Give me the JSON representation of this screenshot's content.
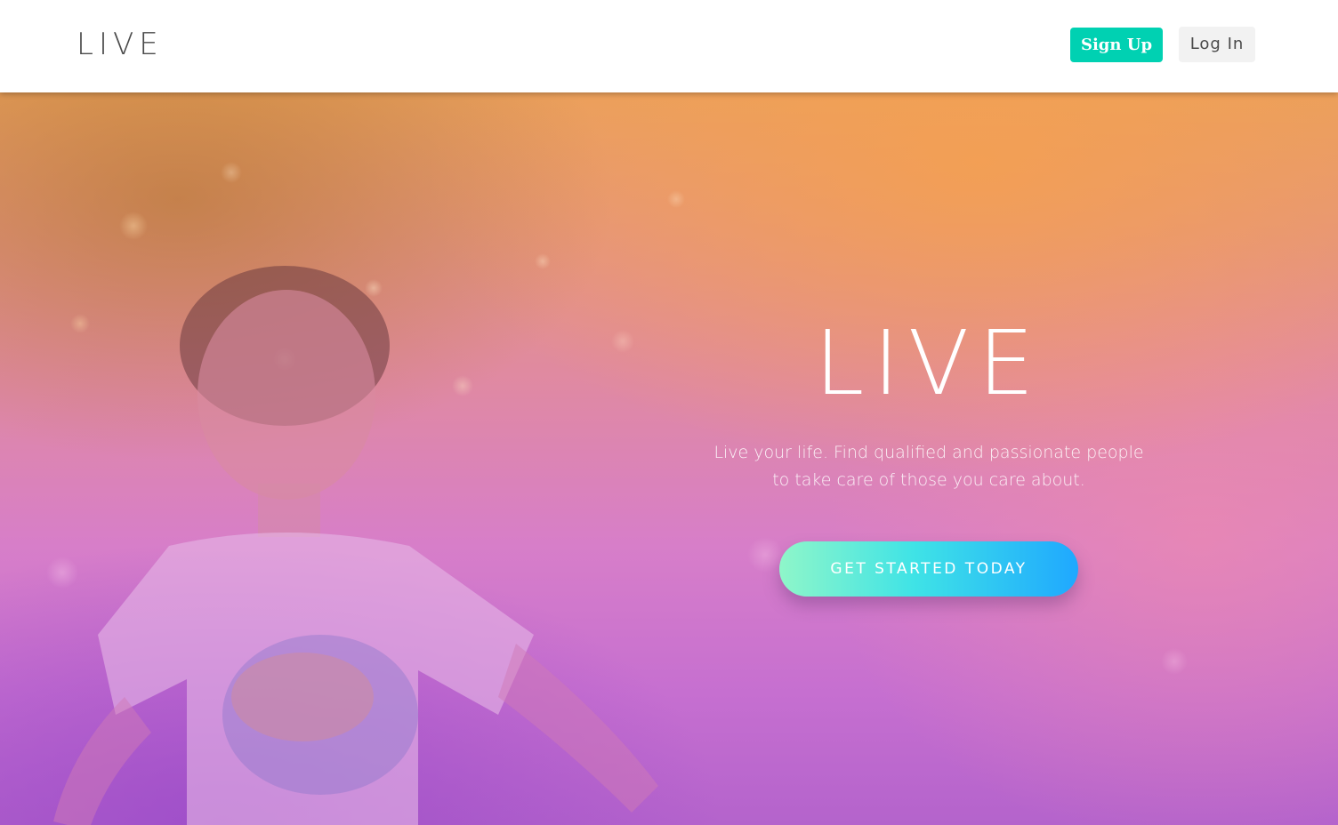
{
  "header": {
    "brand": "LIVE",
    "signup_label": "Sign Up",
    "login_label": "Log In"
  },
  "hero": {
    "title": "LIVE",
    "subtitle_line1": "Live your life. Find qualified and passionate people",
    "subtitle_line2": "to take care of those you care about.",
    "cta_label": "GET STARTED TODAY"
  },
  "colors": {
    "signup_bg": "#00d1b2",
    "login_bg": "#f2f2f2",
    "cta_gradient_start": "#8ff6c9",
    "cta_gradient_end": "#1fa8ff"
  }
}
